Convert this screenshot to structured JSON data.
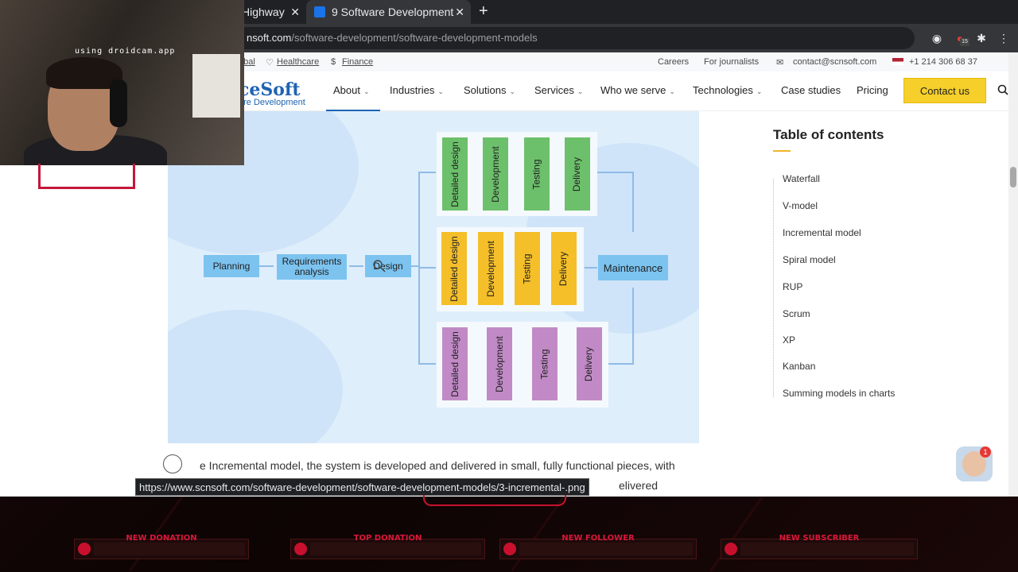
{
  "tabs": {
    "tab1": "Highway",
    "tab2": "9 Software Development",
    "close": "✕",
    "new": "+"
  },
  "address": {
    "host_prefix": "nsoft.com",
    "path": "/software-development/software-development-models"
  },
  "extensions": {
    "badge": "15"
  },
  "utility_bar": {
    "left_1": "obal",
    "left_2": "Healthcare",
    "left_3": "Finance",
    "careers": "Careers",
    "journalists": "For journalists",
    "email": "contact@scnsoft.com",
    "phone": "+1 214 306 68 37"
  },
  "logo": {
    "line1": "ceSoft",
    "line2": "are Development"
  },
  "nav": {
    "items": [
      "About",
      "Industries",
      "Solutions",
      "Services",
      "Who we serve",
      "Technologies",
      "Case studies",
      "Pricing"
    ],
    "cta": "Contact us"
  },
  "diagram": {
    "phases": {
      "planning": "Planning",
      "requirements": "Requirements analysis",
      "design": "Design",
      "maintenance": "Maintenance"
    },
    "build_steps": [
      "Detailed design",
      "Development",
      "Testing",
      "Delivery"
    ],
    "colors": {
      "row1": "#6cc06b",
      "row2": "#f5bf2a",
      "row3": "#c18ac6",
      "phase": "#7cc3f0"
    }
  },
  "toc": {
    "title": "Table of contents",
    "items": [
      "Waterfall",
      "V-model",
      "Incremental model",
      "Spiral model",
      "RUP",
      "Scrum",
      "XP",
      "Kanban",
      "Summing models in charts"
    ]
  },
  "content": {
    "paragraph_1": "e Incremental model, the system is developed and delivered in small, fully functional pieces, with",
    "paragraph_2": "elivered"
  },
  "status_url": "https://www.scnsoft.com/software-development/software-development-models/3-incremental-.png",
  "chat_badge": "1",
  "webcam": {
    "label": "using droidcam.app"
  },
  "stream_widgets": [
    "NEW DONATION",
    "TOP DONATION",
    "NEW FOLLOWER",
    "NEW SUBSCRIBER"
  ]
}
